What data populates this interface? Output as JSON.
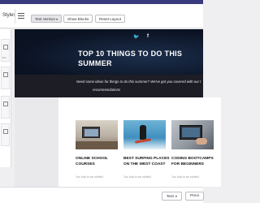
{
  "toolbar": {
    "styles_label": "Styles",
    "version_label": "Test Version",
    "show_blocks_label": "Show Blocks",
    "reset_layout_label": "Reset Layout"
  },
  "sidebar": {
    "items": [
      {
        "label": "Dnl"
      },
      {
        "label": ""
      },
      {
        "label": ""
      },
      {
        "label": ""
      }
    ]
  },
  "email": {
    "social": {
      "twitter": "🐦",
      "facebook": "f"
    },
    "hero_title": "TOP 10 THINGS TO DO THIS SUMMER",
    "intro_line1": "Need some ideas for things to do this summer? We've got you covered with our t",
    "intro_line2": "recommendations",
    "cards": [
      {
        "title": "ONLINE SCHOOL COURSES",
        "snippet": "You had to be stuffed",
        "image": "office"
      },
      {
        "title": "BEST SURFING PLACES ON THE WEST COAST",
        "snippet": "You had to be stuffed",
        "image": "surf"
      },
      {
        "title": "CODING BOOTCAMPS FOR BEGINNERS",
        "snippet": "You had to be stuffed",
        "image": "code"
      }
    ]
  },
  "bottombar": {
    "test_label": "Test",
    "preview_label": "Previ"
  },
  "colors": {
    "top_bar": "#3a3a7e",
    "hero_bg": "#0b1222",
    "subband_bg": "#1d1d25"
  }
}
